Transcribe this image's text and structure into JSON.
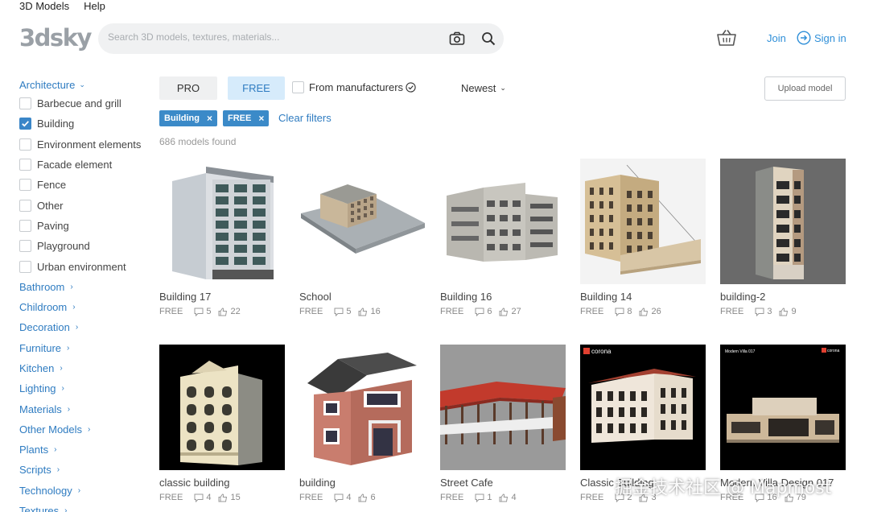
{
  "topmenu": [
    "3D Models",
    "Help"
  ],
  "header": {
    "logo": "3dsky",
    "search_placeholder": "Search 3D models, textures, materials...",
    "join": "Join",
    "signin": "Sign in"
  },
  "sidebar": {
    "active_category": "Architecture",
    "subcategories": [
      {
        "label": "Barbecue and grill",
        "checked": false
      },
      {
        "label": "Building",
        "checked": true
      },
      {
        "label": "Environment elements",
        "checked": false
      },
      {
        "label": "Facade element",
        "checked": false
      },
      {
        "label": "Fence",
        "checked": false
      },
      {
        "label": "Other",
        "checked": false
      },
      {
        "label": "Paving",
        "checked": false
      },
      {
        "label": "Playground",
        "checked": false
      },
      {
        "label": "Urban environment",
        "checked": false
      }
    ],
    "categories": [
      "Bathroom",
      "Childroom",
      "Decoration",
      "Furniture",
      "Kitchen",
      "Lighting",
      "Materials",
      "Other Models",
      "Plants",
      "Scripts",
      "Technology",
      "Textures"
    ]
  },
  "filters": {
    "pro": "PRO",
    "free": "FREE",
    "from_manufacturers": "From manufacturers",
    "sort": "Newest",
    "upload": "Upload model",
    "tags": [
      "Building",
      "FREE"
    ],
    "clear": "Clear filters",
    "found": "686 models found"
  },
  "cards": [
    {
      "title": "Building 17",
      "badge": "FREE",
      "comments": "5",
      "likes": "22"
    },
    {
      "title": "School",
      "badge": "FREE",
      "comments": "5",
      "likes": "16"
    },
    {
      "title": "Building 16",
      "badge": "FREE",
      "comments": "6",
      "likes": "27"
    },
    {
      "title": "Building 14",
      "badge": "FREE",
      "comments": "8",
      "likes": "26"
    },
    {
      "title": "building-2",
      "badge": "FREE",
      "comments": "3",
      "likes": "9"
    },
    {
      "title": "classic building",
      "badge": "FREE",
      "comments": "4",
      "likes": "15"
    },
    {
      "title": "building",
      "badge": "FREE",
      "comments": "4",
      "likes": "6"
    },
    {
      "title": "Street Cafe",
      "badge": "FREE",
      "comments": "1",
      "likes": "4"
    },
    {
      "title": "Classic Building",
      "badge": "FREE",
      "comments": "2",
      "likes": "3"
    },
    {
      "title": "Modern Villa Design 017",
      "badge": "FREE",
      "comments": "16",
      "likes": "79"
    }
  ],
  "thumb_labels": {
    "corona": "corona",
    "villa": "Modern Villa 017"
  },
  "watermark": "掘金技术社区 @ Mapmost",
  "colors": {
    "accent": "#2f7cc1",
    "tag": "#3b8ac8",
    "free_active": "#d6ebfb"
  }
}
